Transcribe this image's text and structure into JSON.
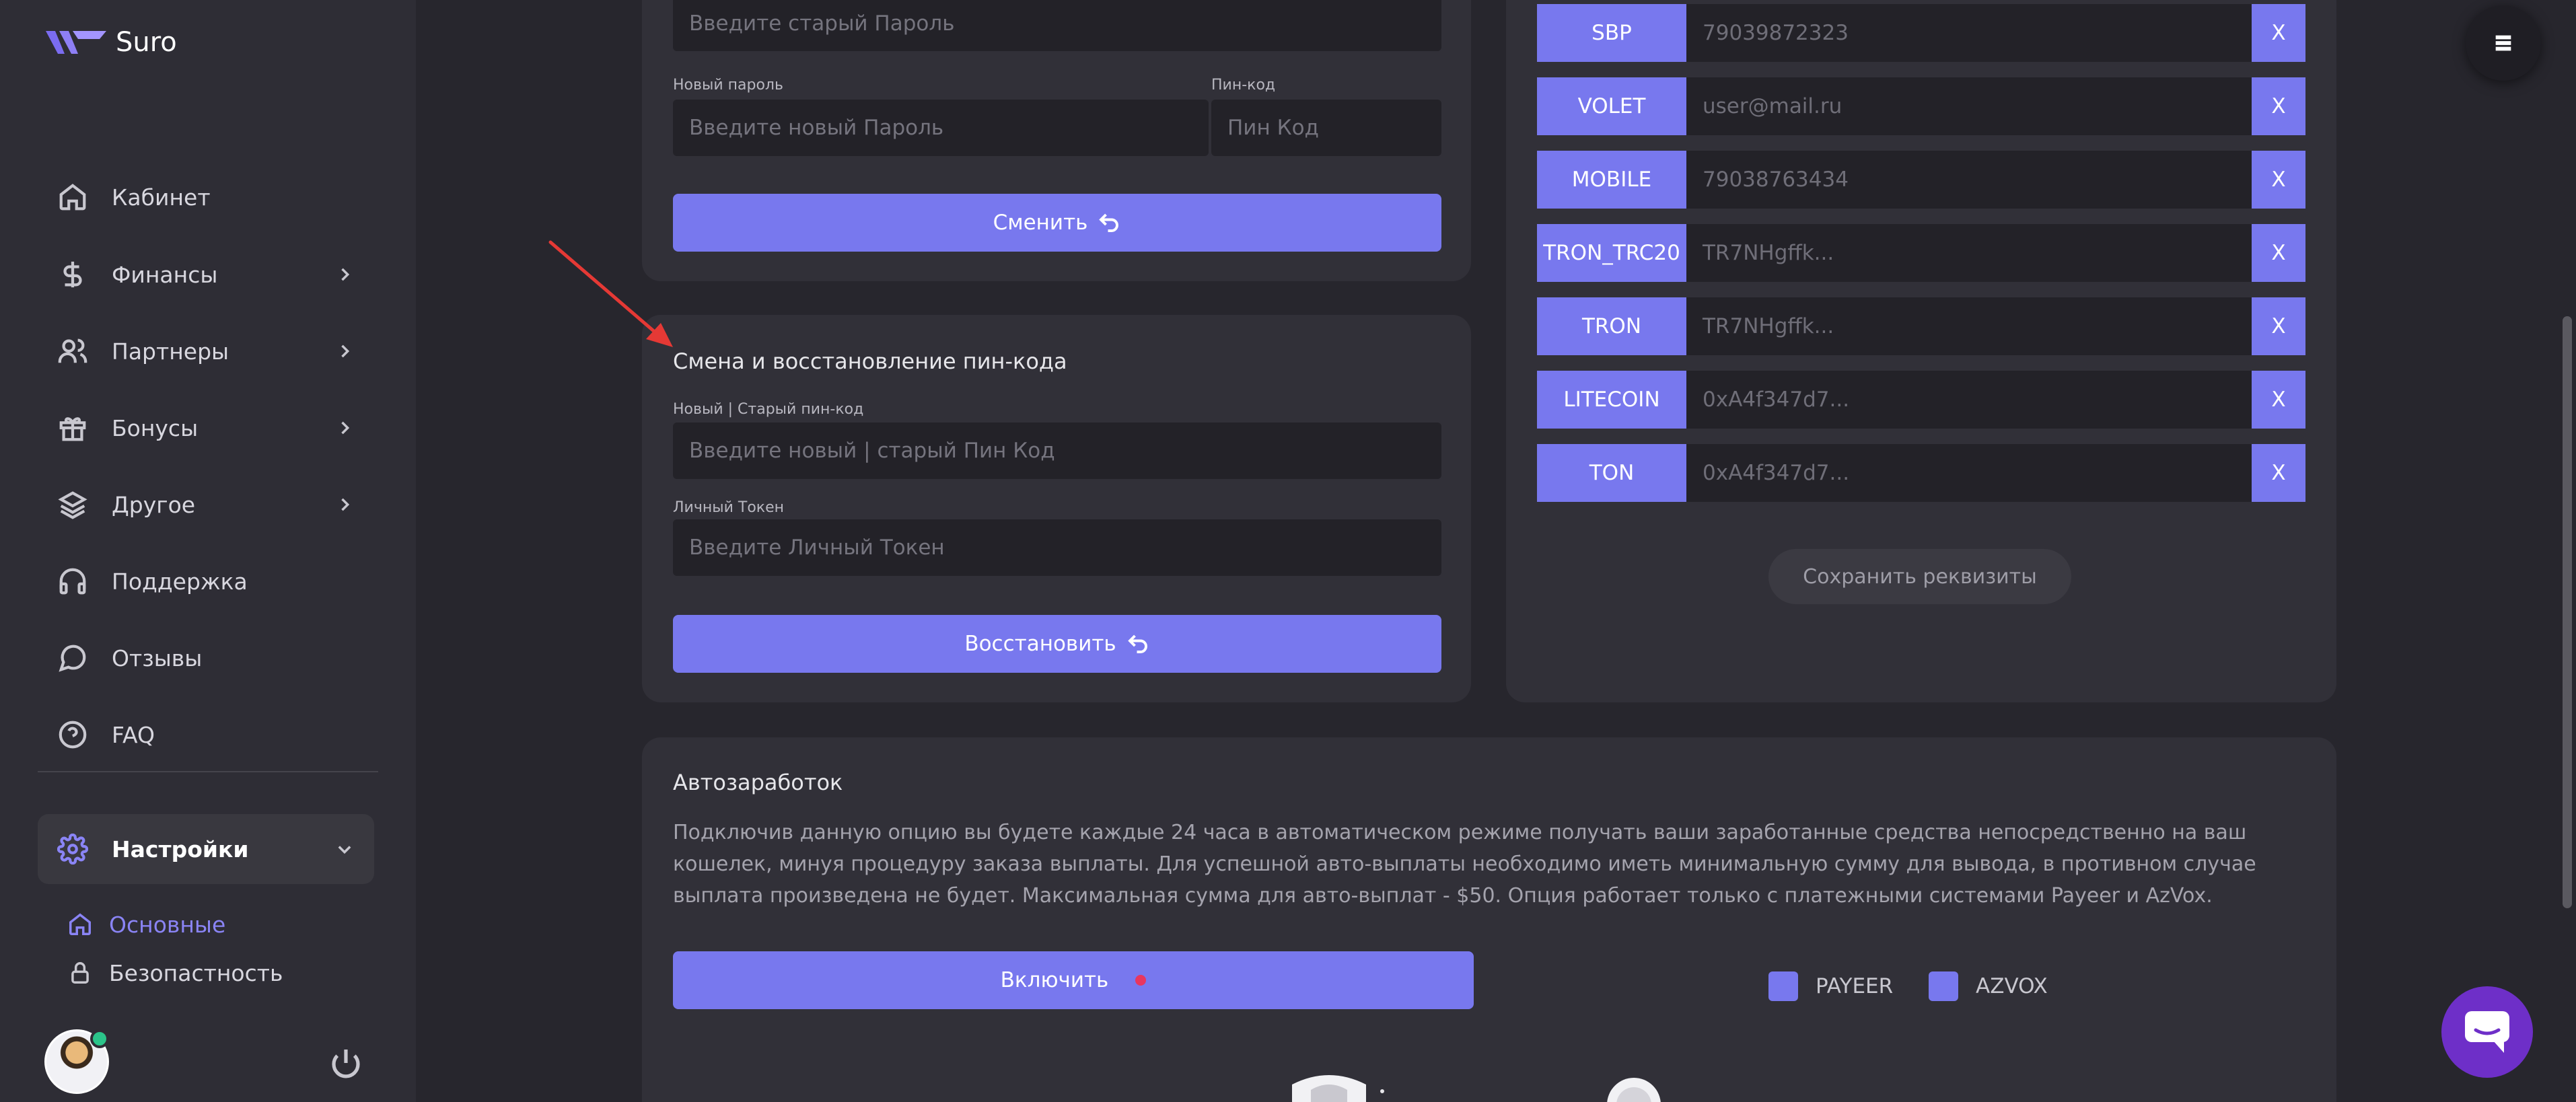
{
  "app": {
    "brand": "Suro"
  },
  "sidebar": {
    "items": [
      {
        "label": "Кабинет",
        "icon": "home-icon"
      },
      {
        "label": "Финансы",
        "icon": "dollar-icon"
      },
      {
        "label": "Партнеры",
        "icon": "users-icon"
      },
      {
        "label": "Бонусы",
        "icon": "gift-icon"
      },
      {
        "label": "Другое",
        "icon": "layers-icon"
      },
      {
        "label": "Поддержка",
        "icon": "headphones-icon"
      },
      {
        "label": "Отзывы",
        "icon": "message-circle-icon"
      },
      {
        "label": "FAQ",
        "icon": "help-circle-icon"
      },
      {
        "label": "Настройки",
        "icon": "gear-icon"
      }
    ],
    "sub_items": [
      {
        "label": "Основные",
        "icon": "home-icon"
      },
      {
        "label": "Безопастность",
        "icon": "lock-icon"
      }
    ]
  },
  "password_card": {
    "old_password_placeholder": "Введите старый Пароль",
    "new_password_label": "Новый пароль",
    "new_password_placeholder": "Введите новый Пароль",
    "pin_label": "Пин-код",
    "pin_placeholder": "Пин Код",
    "submit_label": "Сменить"
  },
  "pin_card": {
    "title": "Смена и восстановление пин-кода",
    "pin_label": "Новый | Старый пин-код",
    "pin_placeholder": "Введите новый | старый Пин Код",
    "token_label": "Личный Токен",
    "token_placeholder": "Введите Личный Токен",
    "submit_label": "Восстановить"
  },
  "requisites": {
    "rows": [
      {
        "tag": "SBP",
        "value": "79039872323",
        "remove": "X"
      },
      {
        "tag": "VOLET",
        "value": "user@mail.ru",
        "remove": "X"
      },
      {
        "tag": "MOBILE",
        "value": "79038763434",
        "remove": "X"
      },
      {
        "tag": "TRON_TRC20",
        "value": "TR7NHgffk...",
        "remove": "X"
      },
      {
        "tag": "TRON",
        "value": "TR7NHgffk...",
        "remove": "X"
      },
      {
        "tag": "LITECOIN",
        "value": "0xA4f347d7...",
        "remove": "X"
      },
      {
        "tag": "TON",
        "value": "0xA4f347d7...",
        "remove": "X"
      }
    ],
    "save_label": "Сохранить реквизиты"
  },
  "autoearn": {
    "title": "Автозаработок",
    "description": "Подключив данную опцию вы будете каждые 24 часа в автоматическом режиме получать ваши заработанные средства непосредственно на ваш кошелек, минуя процедуру заказа выплаты. Для успешной авто-выплаты необходимо иметь минимальную сумму для вывода, в противном случае выплата произведена не будет. Максимальная сумма для авто-выплат - $50. Опция работает только с платежными системами Payeer и AzVox.",
    "enable_label": "Включить",
    "options": [
      {
        "label": "PAYEER"
      },
      {
        "label": "AZVOX"
      }
    ]
  },
  "colors": {
    "accent": "#7878ee",
    "background": "#27262d",
    "sidebar": "#2e2d35",
    "card": "#313038",
    "field": "#232228",
    "annotation_arrow": "#e53935",
    "status_dot": "#e8365f",
    "chat": "#6e2fc8"
  }
}
